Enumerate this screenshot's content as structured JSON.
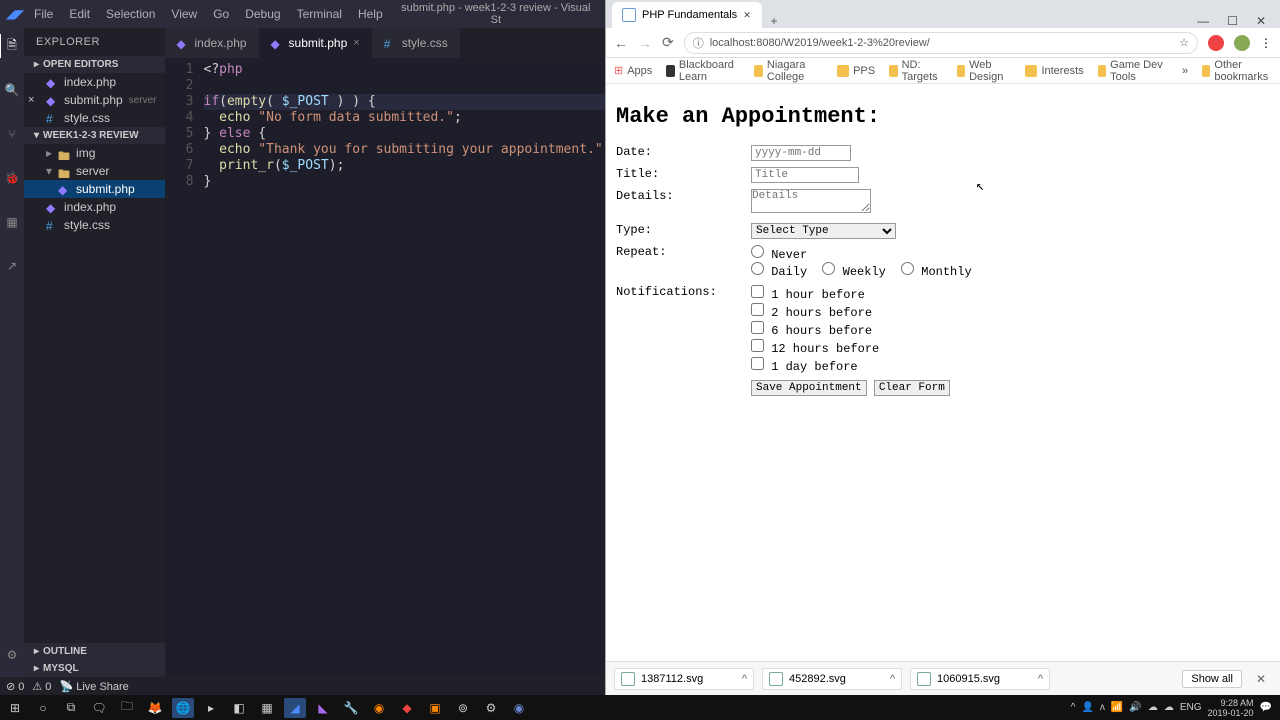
{
  "vscode": {
    "menubar": [
      "File",
      "Edit",
      "Selection",
      "View",
      "Go",
      "Debug",
      "Terminal",
      "Help"
    ],
    "window_title": "submit.php - week1-2-3 review - Visual St",
    "explorer_label": "EXPLORER",
    "sections": {
      "open_editors": "OPEN EDITORS",
      "folder": "WEEK1-2-3 REVIEW",
      "outline": "OUTLINE",
      "mysql": "MYSQL"
    },
    "open_editors": [
      {
        "name": "index.php",
        "icon": "php"
      },
      {
        "name": "submit.php",
        "hint": "server",
        "icon": "php",
        "dirty": true
      },
      {
        "name": "style.css",
        "icon": "css"
      }
    ],
    "tree": [
      {
        "name": "img",
        "type": "folder",
        "indent": 0
      },
      {
        "name": "server",
        "type": "folder",
        "indent": 0,
        "open": true
      },
      {
        "name": "submit.php",
        "type": "php",
        "indent": 1,
        "selected": true
      },
      {
        "name": "index.php",
        "type": "php",
        "indent": 0
      },
      {
        "name": "style.css",
        "type": "css",
        "indent": 0
      }
    ],
    "tabs": [
      {
        "name": "index.php",
        "icon": "php"
      },
      {
        "name": "submit.php",
        "icon": "php",
        "active": true,
        "dirty": true
      },
      {
        "name": "style.css",
        "icon": "css"
      }
    ],
    "code_line_numbers": [
      "1",
      "2",
      "3",
      "4",
      "5",
      "6",
      "7",
      "8"
    ],
    "statusbar": {
      "errors": "⊘ 0",
      "warnings": "⚠ 0",
      "liveshare": "Live Share"
    }
  },
  "chrome": {
    "tab_title": "PHP Fundamentals",
    "url": "localhost:8080/W2019/week1-2-3%20review/",
    "bookmarks": [
      "Apps",
      "Blackboard Learn",
      "Niagara College",
      "PPS",
      "ND: Targets",
      "Web Design",
      "Interests",
      "Game Dev Tools"
    ],
    "other_bookmarks": "Other bookmarks",
    "more": "»"
  },
  "page": {
    "heading": "Make an Appointment:",
    "labels": {
      "date": "Date:",
      "title": "Title:",
      "details": "Details:",
      "type": "Type:",
      "repeat": "Repeat:",
      "notifications": "Notifications:"
    },
    "placeholders": {
      "date": "yyyy-mm-dd",
      "title": "Title",
      "details": "Details"
    },
    "type_default": "Select Type",
    "repeat_options": [
      "Never",
      "Daily",
      "Weekly",
      "Monthly"
    ],
    "notifications": [
      "1 hour before",
      "2 hours before",
      "6 hours before",
      "12 hours before",
      "1 day before"
    ],
    "buttons": {
      "save": "Save Appointment",
      "clear": "Clear Form"
    }
  },
  "downloads": {
    "items": [
      "1387112.svg",
      "452892.svg",
      "1060915.svg"
    ],
    "showall": "Show all"
  },
  "tray": {
    "lang": "ENG",
    "time": "9:28 AM",
    "date": "2019-01-20"
  }
}
